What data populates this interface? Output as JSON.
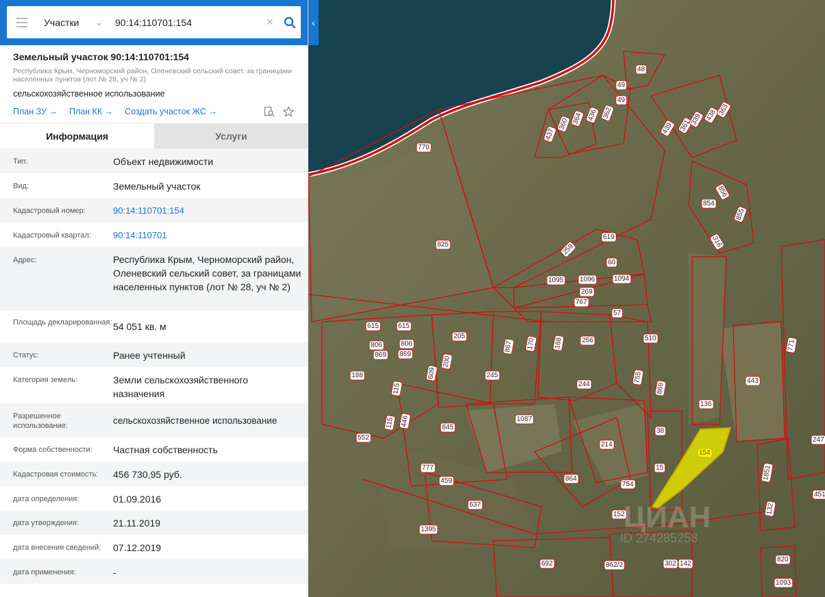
{
  "search": {
    "type_label": "Участки",
    "value": "90:14:110701:154"
  },
  "object": {
    "title": "Земельный участок 90:14:110701:154",
    "address": "Республика Крым, Черноморский район, Оленевский сельский совет, за границами населенных пунктов (лот № 28, уч № 2)",
    "purpose": "сельскохозяйственное использование",
    "links": [
      "План ЗУ",
      "План КК",
      "Создать участок ЖС"
    ]
  },
  "tabs": [
    "Информация",
    "Услуги"
  ],
  "info": [
    {
      "label": "Тип:",
      "value": "Объект недвижимости"
    },
    {
      "label": "Вид:",
      "value": "Земельный участок"
    },
    {
      "label": "Кадастровый номер:",
      "value": "90:14:110701:154"
    },
    {
      "label": "Кадастровый квартал:",
      "value": "90:14:110701"
    },
    {
      "label": "Адрес:",
      "value": "Республика Крым, Черноморский район, Оленевский сельский совет, за границами населенных пунктов (лот № 28, уч № 2)"
    },
    {
      "label": "Площадь декларированная:",
      "value": "54 051 кв. м"
    },
    {
      "label": "Статус:",
      "value": "Ранее учтенный"
    },
    {
      "label": "Категория земель:",
      "value": "Земли сельскохозяйственного назначения"
    },
    {
      "label": "Разрешенное использование:",
      "value": "сельскохозяйственное использование"
    },
    {
      "label": "Форма собственности:",
      "value": "Частная собственность"
    },
    {
      "label": "Кадастровая стоимость:",
      "value": "456 730,95 руб."
    },
    {
      "label": "дата определения:",
      "value": "01.09.2016"
    },
    {
      "label": "дата утверждения:",
      "value": "21.11.2019"
    },
    {
      "label": "дата внесения сведений:",
      "value": "07.12.2019"
    },
    {
      "label": "дата применения:",
      "value": "-"
    }
  ],
  "map": {
    "selected_parcel": "154",
    "parcels": [
      "48",
      "49",
      "49",
      "437",
      "360",
      "364",
      "436",
      "362",
      "439",
      "361",
      "339",
      "438",
      "363",
      "856",
      "854",
      "855",
      "316",
      "770",
      "825",
      "259",
      "619",
      "60",
      "1095",
      "1096",
      "1094",
      "269",
      "767",
      "57",
      "615",
      "615",
      "806",
      "806",
      "869",
      "869",
      "205",
      "867",
      "170",
      "168",
      "256",
      "510",
      "188",
      "115",
      "609",
      "200",
      "245",
      "244",
      "755",
      "869",
      "443",
      "771",
      "552",
      "115",
      "446",
      "845",
      "1087",
      "214",
      "38",
      "136",
      "154",
      "247",
      "777",
      "459",
      "864",
      "754",
      "15",
      "1851",
      "451",
      "637",
      "152",
      "132",
      "1395",
      "692",
      "862/2",
      "302",
      "142",
      "820",
      "1093"
    ],
    "watermark": "ЦИАН",
    "watermark_id": "ID 274285258",
    "colors": {
      "boundary": "#d40d0d",
      "selected_fill": "#e6e600",
      "sea": "#15414f",
      "land": "#6e6a48"
    }
  }
}
